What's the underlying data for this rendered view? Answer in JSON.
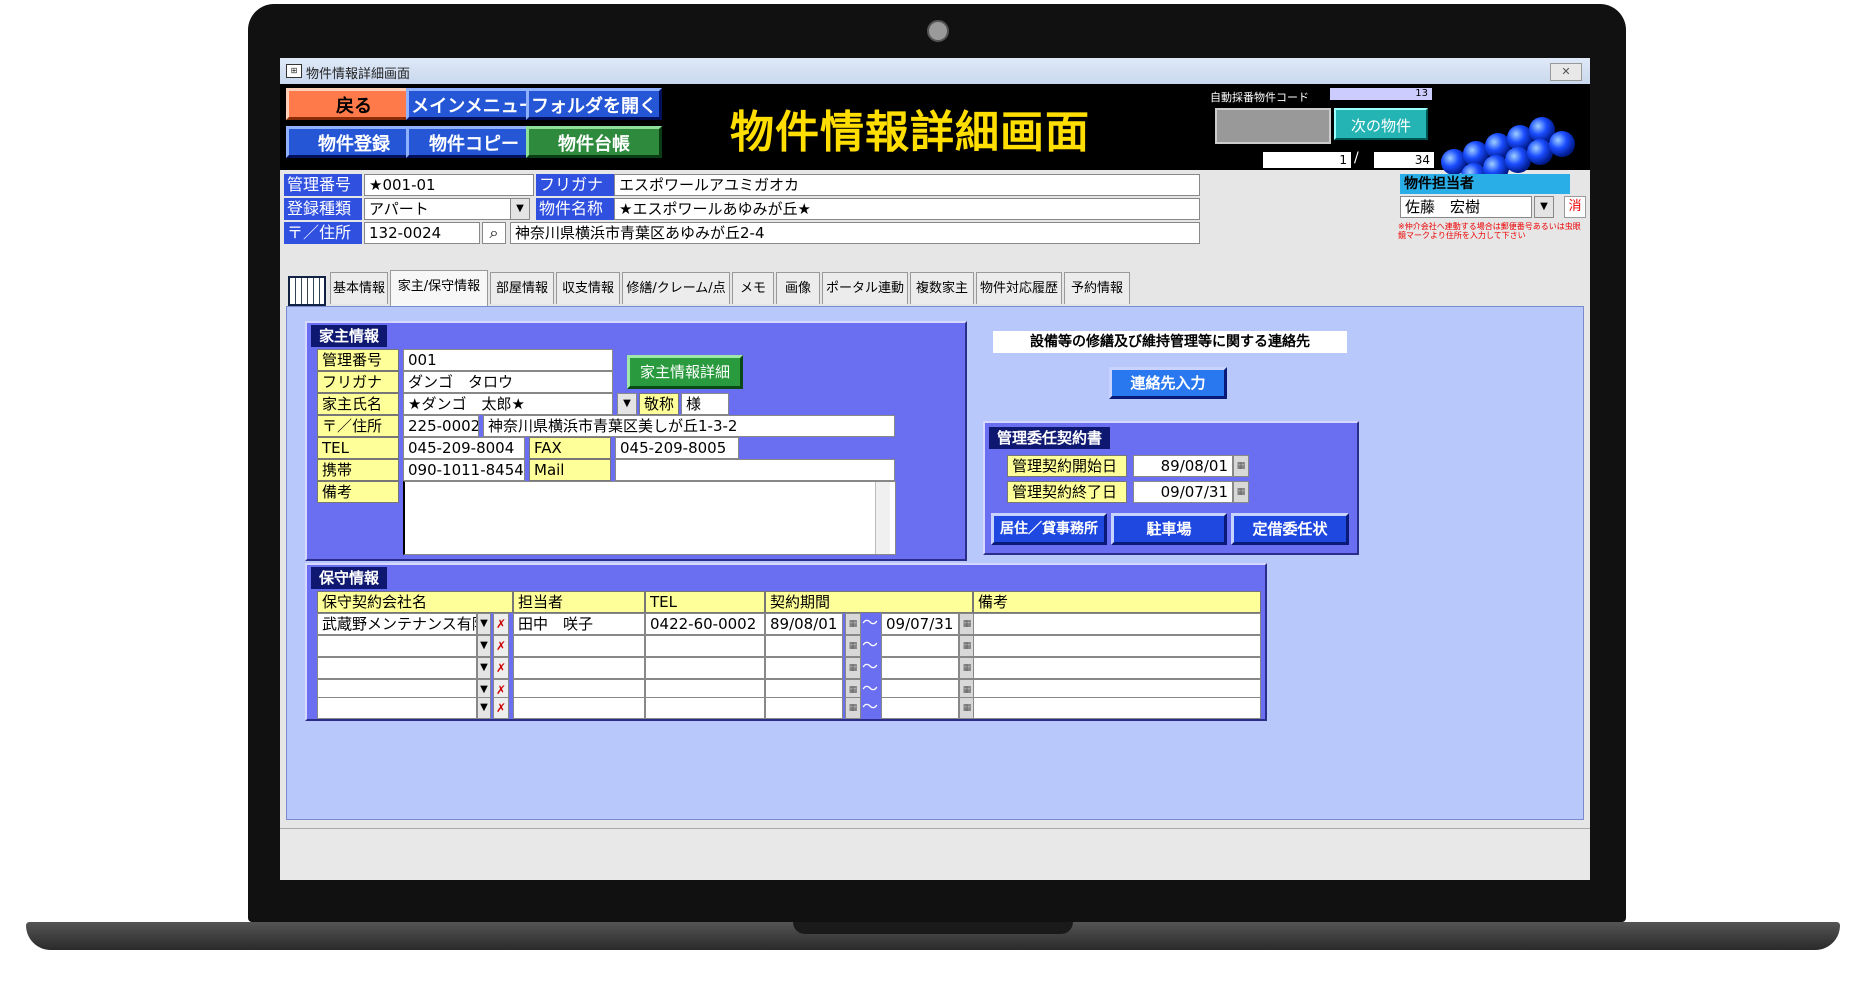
{
  "window": {
    "title": "物件情報詳細画面",
    "close_label": "✕"
  },
  "header": {
    "buttons": {
      "back": "戻る",
      "main_menu": "メインメニュー",
      "open_folder": "フォルダを開く",
      "register": "物件登録",
      "copy": "物件コピー",
      "ledger": "物件台帳"
    },
    "title": "物件情報詳細画面",
    "auto_code_label": "自動採番物件コード",
    "auto_code_value": "13",
    "next_button": "次の物件",
    "record_current": "1",
    "record_separator": "/",
    "record_total": "34"
  },
  "property": {
    "labels": {
      "management_no": "管理番号",
      "furigana": "フリガナ",
      "reg_type": "登録種類",
      "name": "物件名称",
      "address": "〒／住所"
    },
    "management_no": "★001-01",
    "furigana": "エスポワールアユミガオカ",
    "reg_type": "アパート",
    "name": "★エスポワールあゆみが丘★",
    "zip": "132-0024",
    "address": "神奈川県横浜市青葉区あゆみが丘2-4",
    "staff_header": "物件担当者",
    "staff": "佐藤　宏樹",
    "clear_button": "消",
    "note": "※仲介会社へ連動する場合は郵便番号あるいは虫眼鏡マークより住所を入力して下さい"
  },
  "tabs": [
    "基本情報",
    "家主/保守情報",
    "部屋情報",
    "収支情報",
    "修繕/クレーム/点検",
    "メモ",
    "画像",
    "ポータル連動",
    "複数家主",
    "物件対応履歴",
    "予約情報"
  ],
  "owner": {
    "section_title": "家主情報",
    "labels": {
      "management_no": "管理番号",
      "furigana": "フリガナ",
      "name": "家主氏名",
      "honorific": "敬称",
      "address": "〒／住所",
      "tel": "TEL",
      "fax": "FAX",
      "mobile": "携帯",
      "mail": "Mail",
      "remarks": "備考"
    },
    "management_no": "001",
    "furigana": "ダンゴ　タロウ",
    "name": "★ダンゴ　太郎★",
    "honorific": "様",
    "zip": "225-0002",
    "address": "神奈川県横浜市青葉区美しが丘1-3-2",
    "tel": "045-209-8004",
    "fax": "045-209-8005",
    "mobile": "090-1011-8454",
    "mail": "",
    "remarks": "",
    "detail_button": "家主情報詳細"
  },
  "contact": {
    "title": "設備等の修繕及び維持管理等に関する連絡先",
    "input_button": "連絡先入力"
  },
  "contract": {
    "section_title": "管理委任契約書",
    "start_label": "管理契約開始日",
    "start": "89/08/01",
    "end_label": "管理契約終了日",
    "end": "09/07/31",
    "buttons": {
      "residence": "居住／貸事務所",
      "parking": "駐車場",
      "fixed_term": "定借委任状"
    }
  },
  "maintenance": {
    "section_title": "保守情報",
    "headers": {
      "company": "保守契約会社名",
      "person": "担当者",
      "tel": "TEL",
      "period": "契約期間",
      "remarks": "備考"
    },
    "tilde": "〜",
    "rows": [
      {
        "company": "武蔵野メンテナンス有限会社",
        "person": "田中　咲子",
        "tel": "0422-60-0002",
        "start": "89/08/01",
        "end": "09/07/31",
        "remarks": ""
      },
      {
        "company": "",
        "person": "",
        "tel": "",
        "start": "",
        "end": "",
        "remarks": ""
      },
      {
        "company": "",
        "person": "",
        "tel": "",
        "start": "",
        "end": "",
        "remarks": ""
      },
      {
        "company": "",
        "person": "",
        "tel": "",
        "start": "",
        "end": "",
        "remarks": ""
      },
      {
        "company": "",
        "person": "",
        "tel": "",
        "start": "",
        "end": "",
        "remarks": ""
      }
    ]
  },
  "colors": {
    "header_bg": "#000000",
    "title_yellow": "#ffde00",
    "panel_blue": "#6a6ef0",
    "label_yellow": "#ffff99",
    "content_bg": "#b8c8fa"
  }
}
